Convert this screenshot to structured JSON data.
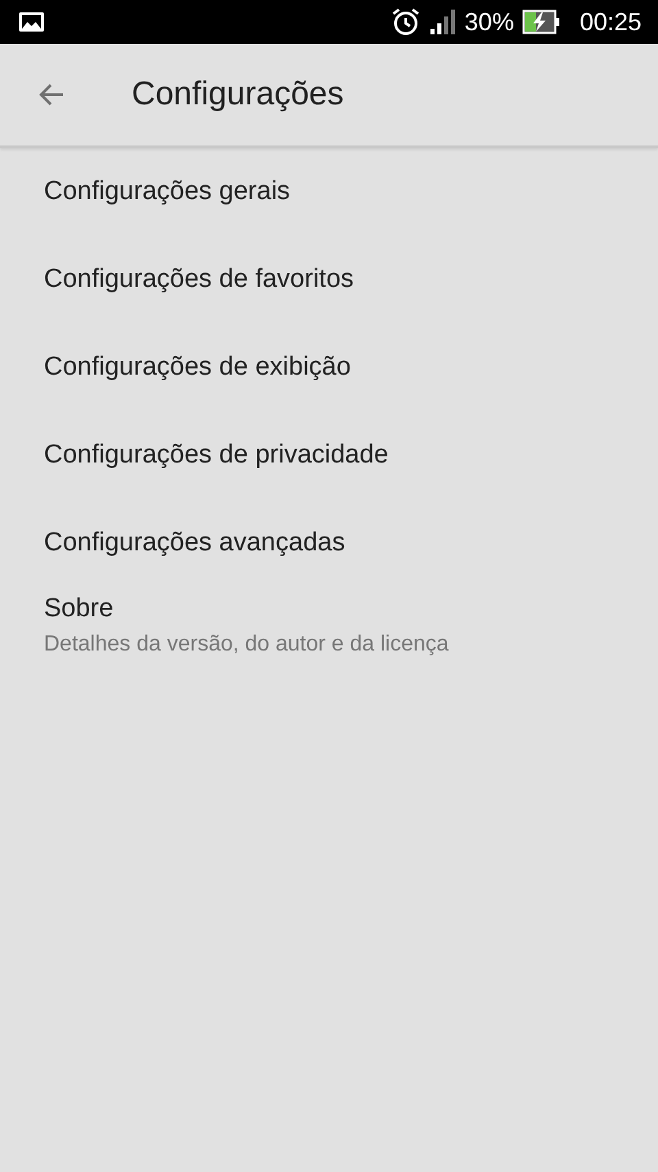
{
  "status_bar": {
    "battery_percent": "30%",
    "time": "00:25"
  },
  "toolbar": {
    "title": "Configurações"
  },
  "items": [
    {
      "title": "Configurações gerais"
    },
    {
      "title": "Configurações de favoritos"
    },
    {
      "title": "Configurações de exibição"
    },
    {
      "title": "Configurações de privacidade"
    },
    {
      "title": "Configurações avançadas"
    },
    {
      "title": "Sobre",
      "summary": "Detalhes da versão, do autor e da licença"
    }
  ]
}
